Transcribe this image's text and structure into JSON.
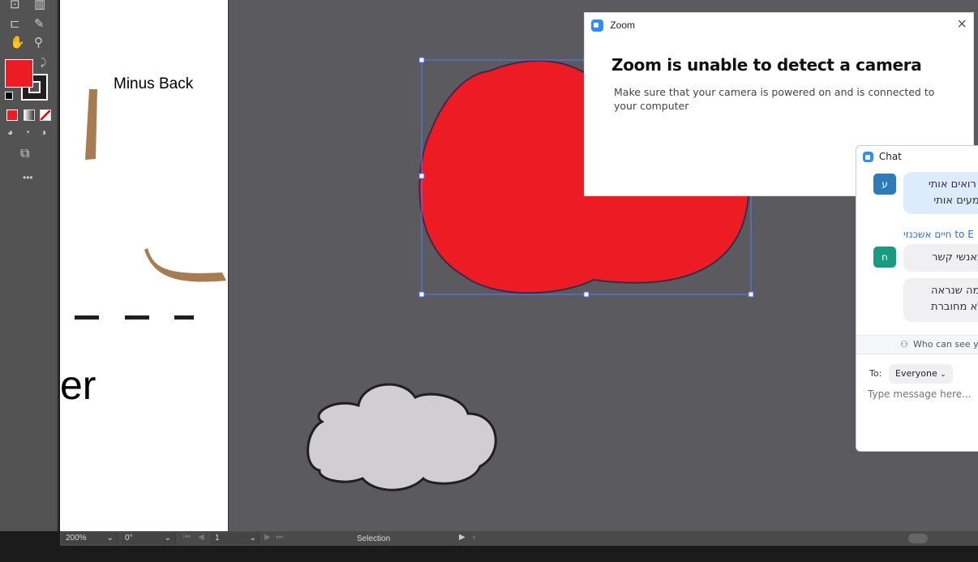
{
  "artboard": {
    "label": "Minus Back",
    "big_text": "er"
  },
  "dialog": {
    "app": "Zoom",
    "title": "Zoom is unable to detect a camera",
    "message": "Make sure that your camera is powered on and is connected to your computer",
    "close": "×"
  },
  "chat": {
    "title": "Chat",
    "messages": [
      {
        "avatar": "ע",
        "avatar_color": "#2e7bb8",
        "lines": [
          "לא רואים אותי",
          "ושומעים אותי"
        ]
      },
      {
        "sender": "חיים אשכנזי",
        "to": "to E",
        "avatar": "ח",
        "avatar_color": "#1a9b7f",
        "lines": [
          "ר באנשי קשר"
        ]
      },
      {
        "lines": [
          "ל, מה שנראה",
          "ר לא מחוברת"
        ]
      }
    ],
    "who_can_see": "Who can see yo",
    "to_label": "To:",
    "recipient": "Everyone",
    "placeholder": "Type message here..."
  },
  "statusbar": {
    "zoom": "200%",
    "rotation": "0°",
    "artboard": "1",
    "tool": "Selection"
  },
  "colors": {
    "fill": "#ed1c24",
    "canvas": "#5b5a5e",
    "zoom_blue": "#2d8cff"
  }
}
